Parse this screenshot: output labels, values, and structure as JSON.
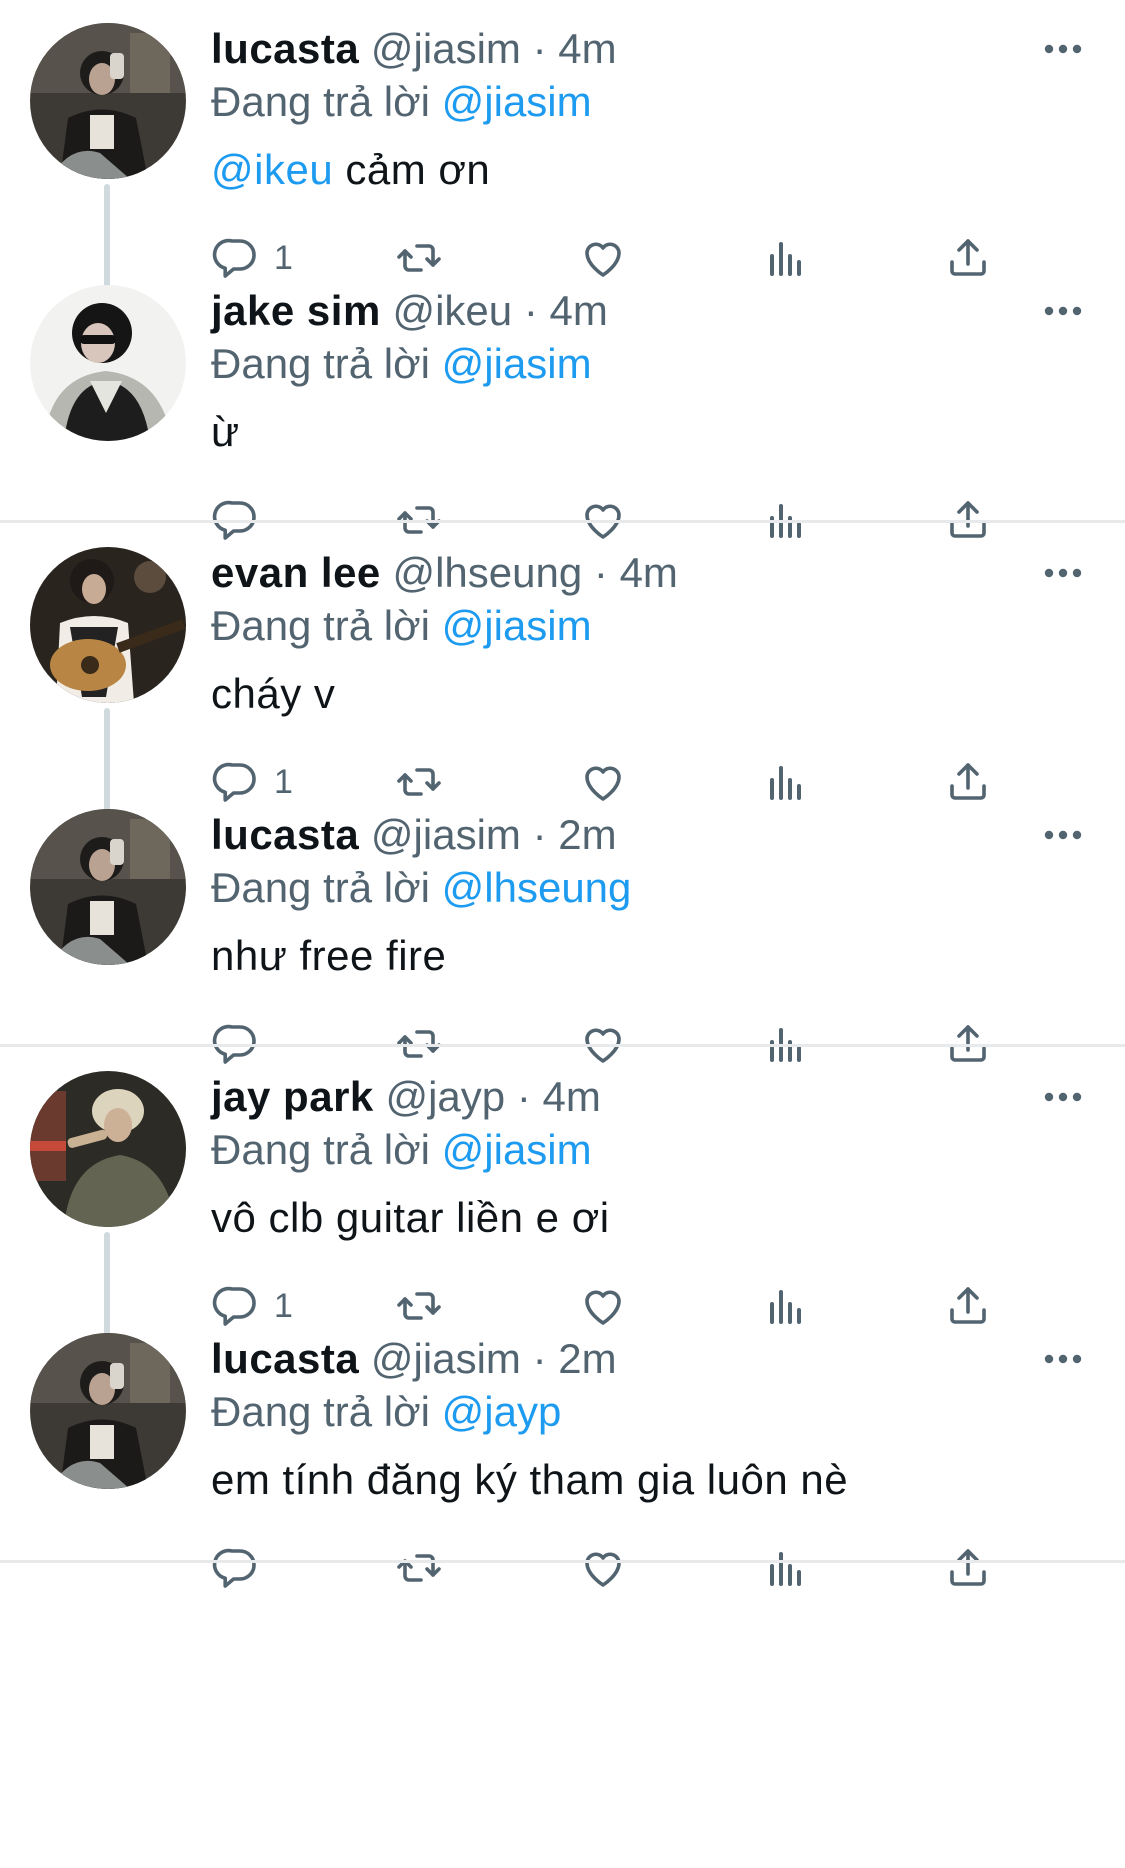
{
  "colors": {
    "accent": "#1d9bf0",
    "secondary_text": "#536471",
    "primary_text": "#0f1419",
    "thread_line": "#cfd9de",
    "divider": "#e7e9ea"
  },
  "icons": {
    "reply": "reply-icon",
    "retweet": "retweet-icon",
    "like": "heart-icon",
    "views": "views-icon",
    "share": "share-icon",
    "more": "more-icon"
  },
  "tweets": [
    {
      "name": "lucasta",
      "handle": "@jiasim",
      "sep": "·",
      "time": "4m",
      "reply_prefix": "Đang trả lời",
      "reply_to": "@jiasim",
      "mention": "@ikeu",
      "text": "cảm ơn",
      "reply_count": "1"
    },
    {
      "name": "jake sim",
      "handle": "@ikeu",
      "sep": "·",
      "time": "4m",
      "reply_prefix": "Đang trả lời",
      "reply_to": "@jiasim",
      "mention": "",
      "text": "ừ",
      "reply_count": ""
    },
    {
      "name": "evan lee",
      "handle": "@lhseung",
      "sep": "·",
      "time": "4m",
      "reply_prefix": "Đang trả lời",
      "reply_to": "@jiasim",
      "mention": "",
      "text": "cháy v",
      "reply_count": "1"
    },
    {
      "name": "lucasta",
      "handle": "@jiasim",
      "sep": "·",
      "time": "2m",
      "reply_prefix": "Đang trả lời",
      "reply_to": "@lhseung",
      "mention": "",
      "text": "như free fire",
      "reply_count": ""
    },
    {
      "name": "jay park",
      "handle": "@jayp",
      "sep": "·",
      "time": "4m",
      "reply_prefix": "Đang trả lời",
      "reply_to": "@jiasim",
      "mention": "",
      "text": "vô clb guitar liền e ơi",
      "reply_count": "1"
    },
    {
      "name": "lucasta",
      "handle": "@jiasim",
      "sep": "·",
      "time": "2m",
      "reply_prefix": "Đang trả lời",
      "reply_to": "@jayp",
      "mention": "",
      "text": "em tính đăng ký tham gia luôn nè",
      "reply_count": ""
    }
  ]
}
